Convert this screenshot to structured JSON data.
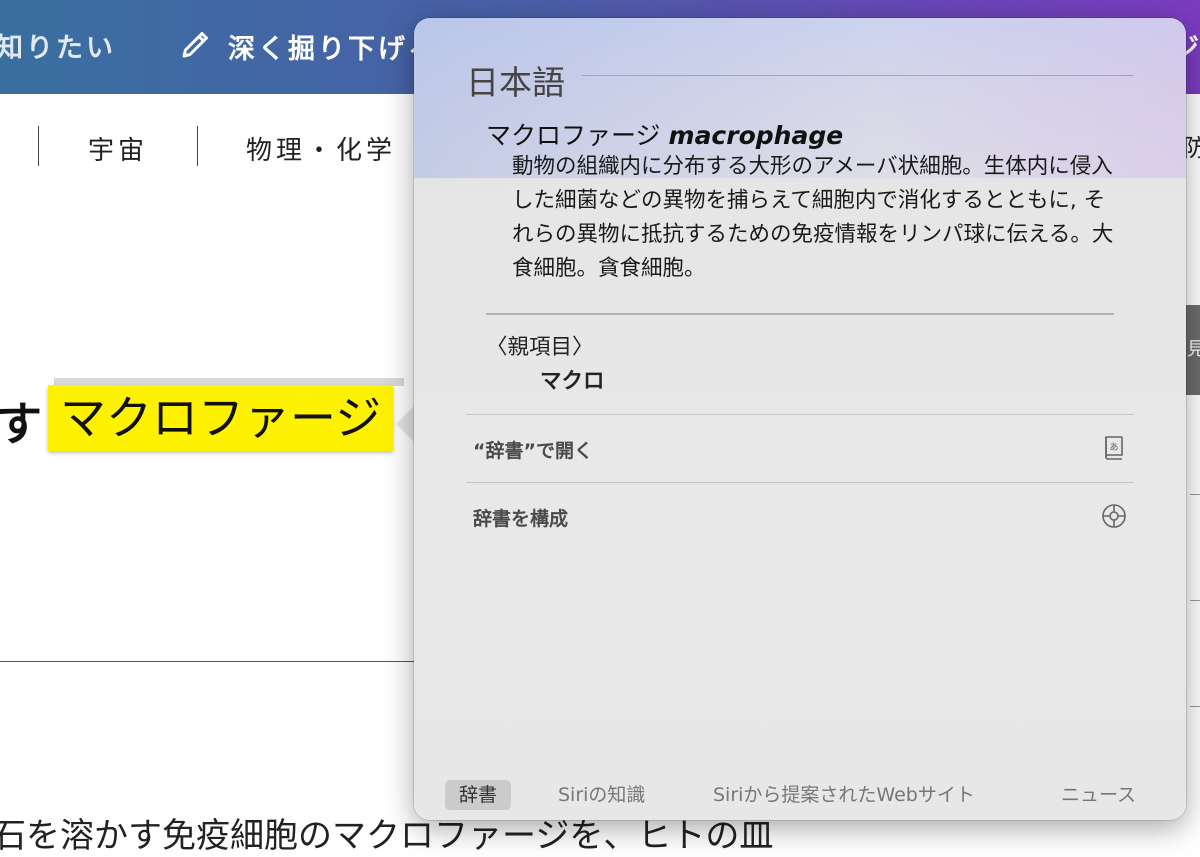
{
  "page": {
    "topbar": {
      "item1": "知りたい",
      "item2": "深く掘り下げる",
      "item3": "ジ"
    },
    "categories": [
      "宇宙",
      "物理・化学"
    ],
    "right_edge_category": "防",
    "heading_prefix": "す",
    "highlighted_word": "マクロファージ",
    "bottom_text": "石を溶かす免疫細胞のマクロファージを、ヒトの皿",
    "right_tab_glyph": "見"
  },
  "dictionary_popover": {
    "language_title": "日本語",
    "entry": {
      "headword": "マクロファージ",
      "english": "macrophage",
      "definition": "動物の組織内に分布する大形のアメーバ状細胞。生体内に侵入した細菌などの異物を捕らえて細胞内で消化するとともに, それらの異物に抵抗するための免疫情報をリンパ球に伝える。大食細胞。貪食細胞。"
    },
    "parent": {
      "label": "〈親項目〉",
      "word": "マクロ"
    },
    "menu": [
      {
        "label": "“辞書”で開く",
        "icon": "dictionary-book-icon"
      },
      {
        "label": "辞書を構成",
        "icon": "gear-icon"
      }
    ],
    "tabs": [
      {
        "label": "辞書",
        "active": true
      },
      {
        "label": "Siriの知識",
        "active": false
      },
      {
        "label": "Siriから提案されたWebサイト",
        "active": false
      },
      {
        "label": "ニュース",
        "active": false
      }
    ]
  }
}
